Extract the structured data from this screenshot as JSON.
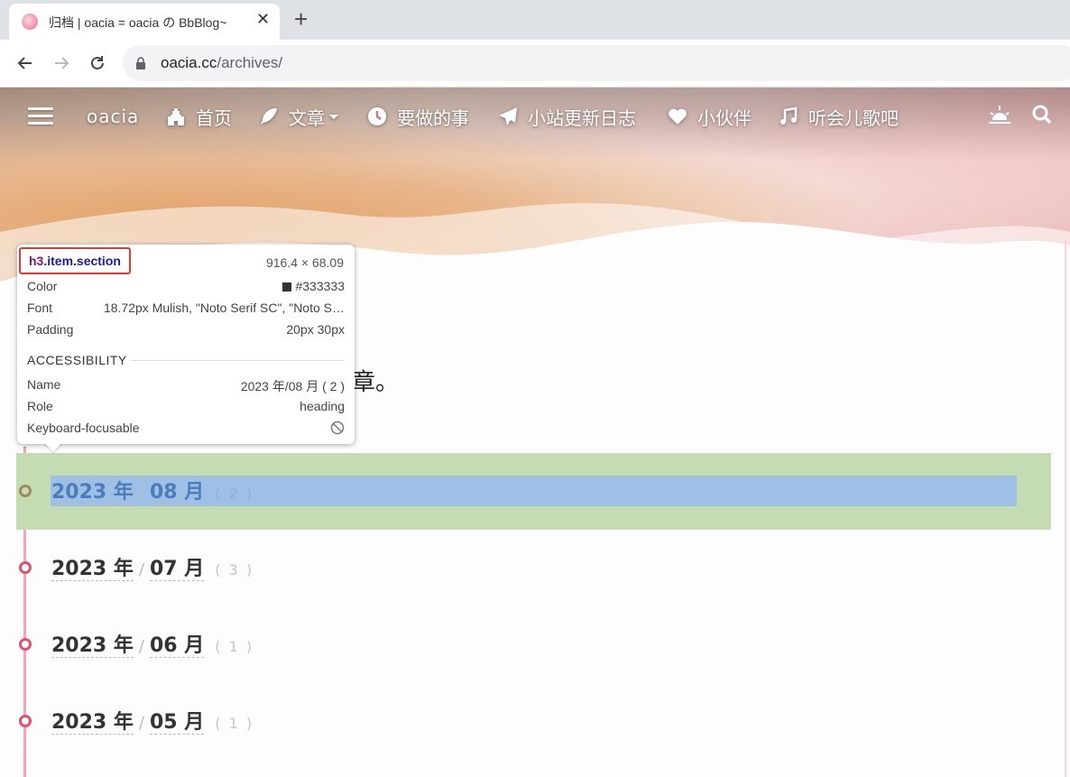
{
  "browser": {
    "tab_title": "归档 | oacia = oacia の BbBlog~",
    "tab_close": "✕",
    "new_tab": "+",
    "url_host": "oacia.cc",
    "url_path": "/archives/"
  },
  "nav": {
    "brand": "oacia",
    "items": [
      {
        "label": "首页",
        "icon": "castle-icon"
      },
      {
        "label": "文章",
        "icon": "feather-icon"
      },
      {
        "label": "要做的事",
        "icon": "clock-icon"
      },
      {
        "label": "小站更新日志",
        "icon": "paper-plane-icon"
      },
      {
        "label": "小伙伴",
        "icon": "heart-icon"
      },
      {
        "label": "听会儿歌吧",
        "icon": "music-icon"
      }
    ]
  },
  "intro_fragment": "章。",
  "sections": [
    {
      "year": "2023 年",
      "month": "08 月",
      "count": "( 2 )"
    },
    {
      "year": "2023 年",
      "month": "07 月",
      "count": "( 3 )"
    },
    {
      "year": "2023 年",
      "month": "06 月",
      "count": "( 1 )"
    },
    {
      "year": "2023 年",
      "month": "05 月",
      "count": "( 1 )"
    }
  ],
  "section_sep": "/",
  "tooltip": {
    "tag": "h3",
    "classes": ".item.section",
    "dims": "916.4 × 68.09",
    "color_label": "Color",
    "color_value": "#333333",
    "font_label": "Font",
    "font_value": "18.72px Mulish, \"Noto Serif SC\", \"Noto S…",
    "padding_label": "Padding",
    "padding_value": "20px 30px",
    "accessibility_header": "ACCESSIBILITY",
    "name_label": "Name",
    "name_value": "2023 年/08 月 ( 2 )",
    "role_label": "Role",
    "role_value": "heading",
    "focusable_label": "Keyboard-focusable"
  },
  "colors": {
    "timeline": "#f3a7b5",
    "dot": "#e0516d",
    "highlight_padding": "#c3dcb2",
    "highlight_content": "#9fc0e6"
  }
}
